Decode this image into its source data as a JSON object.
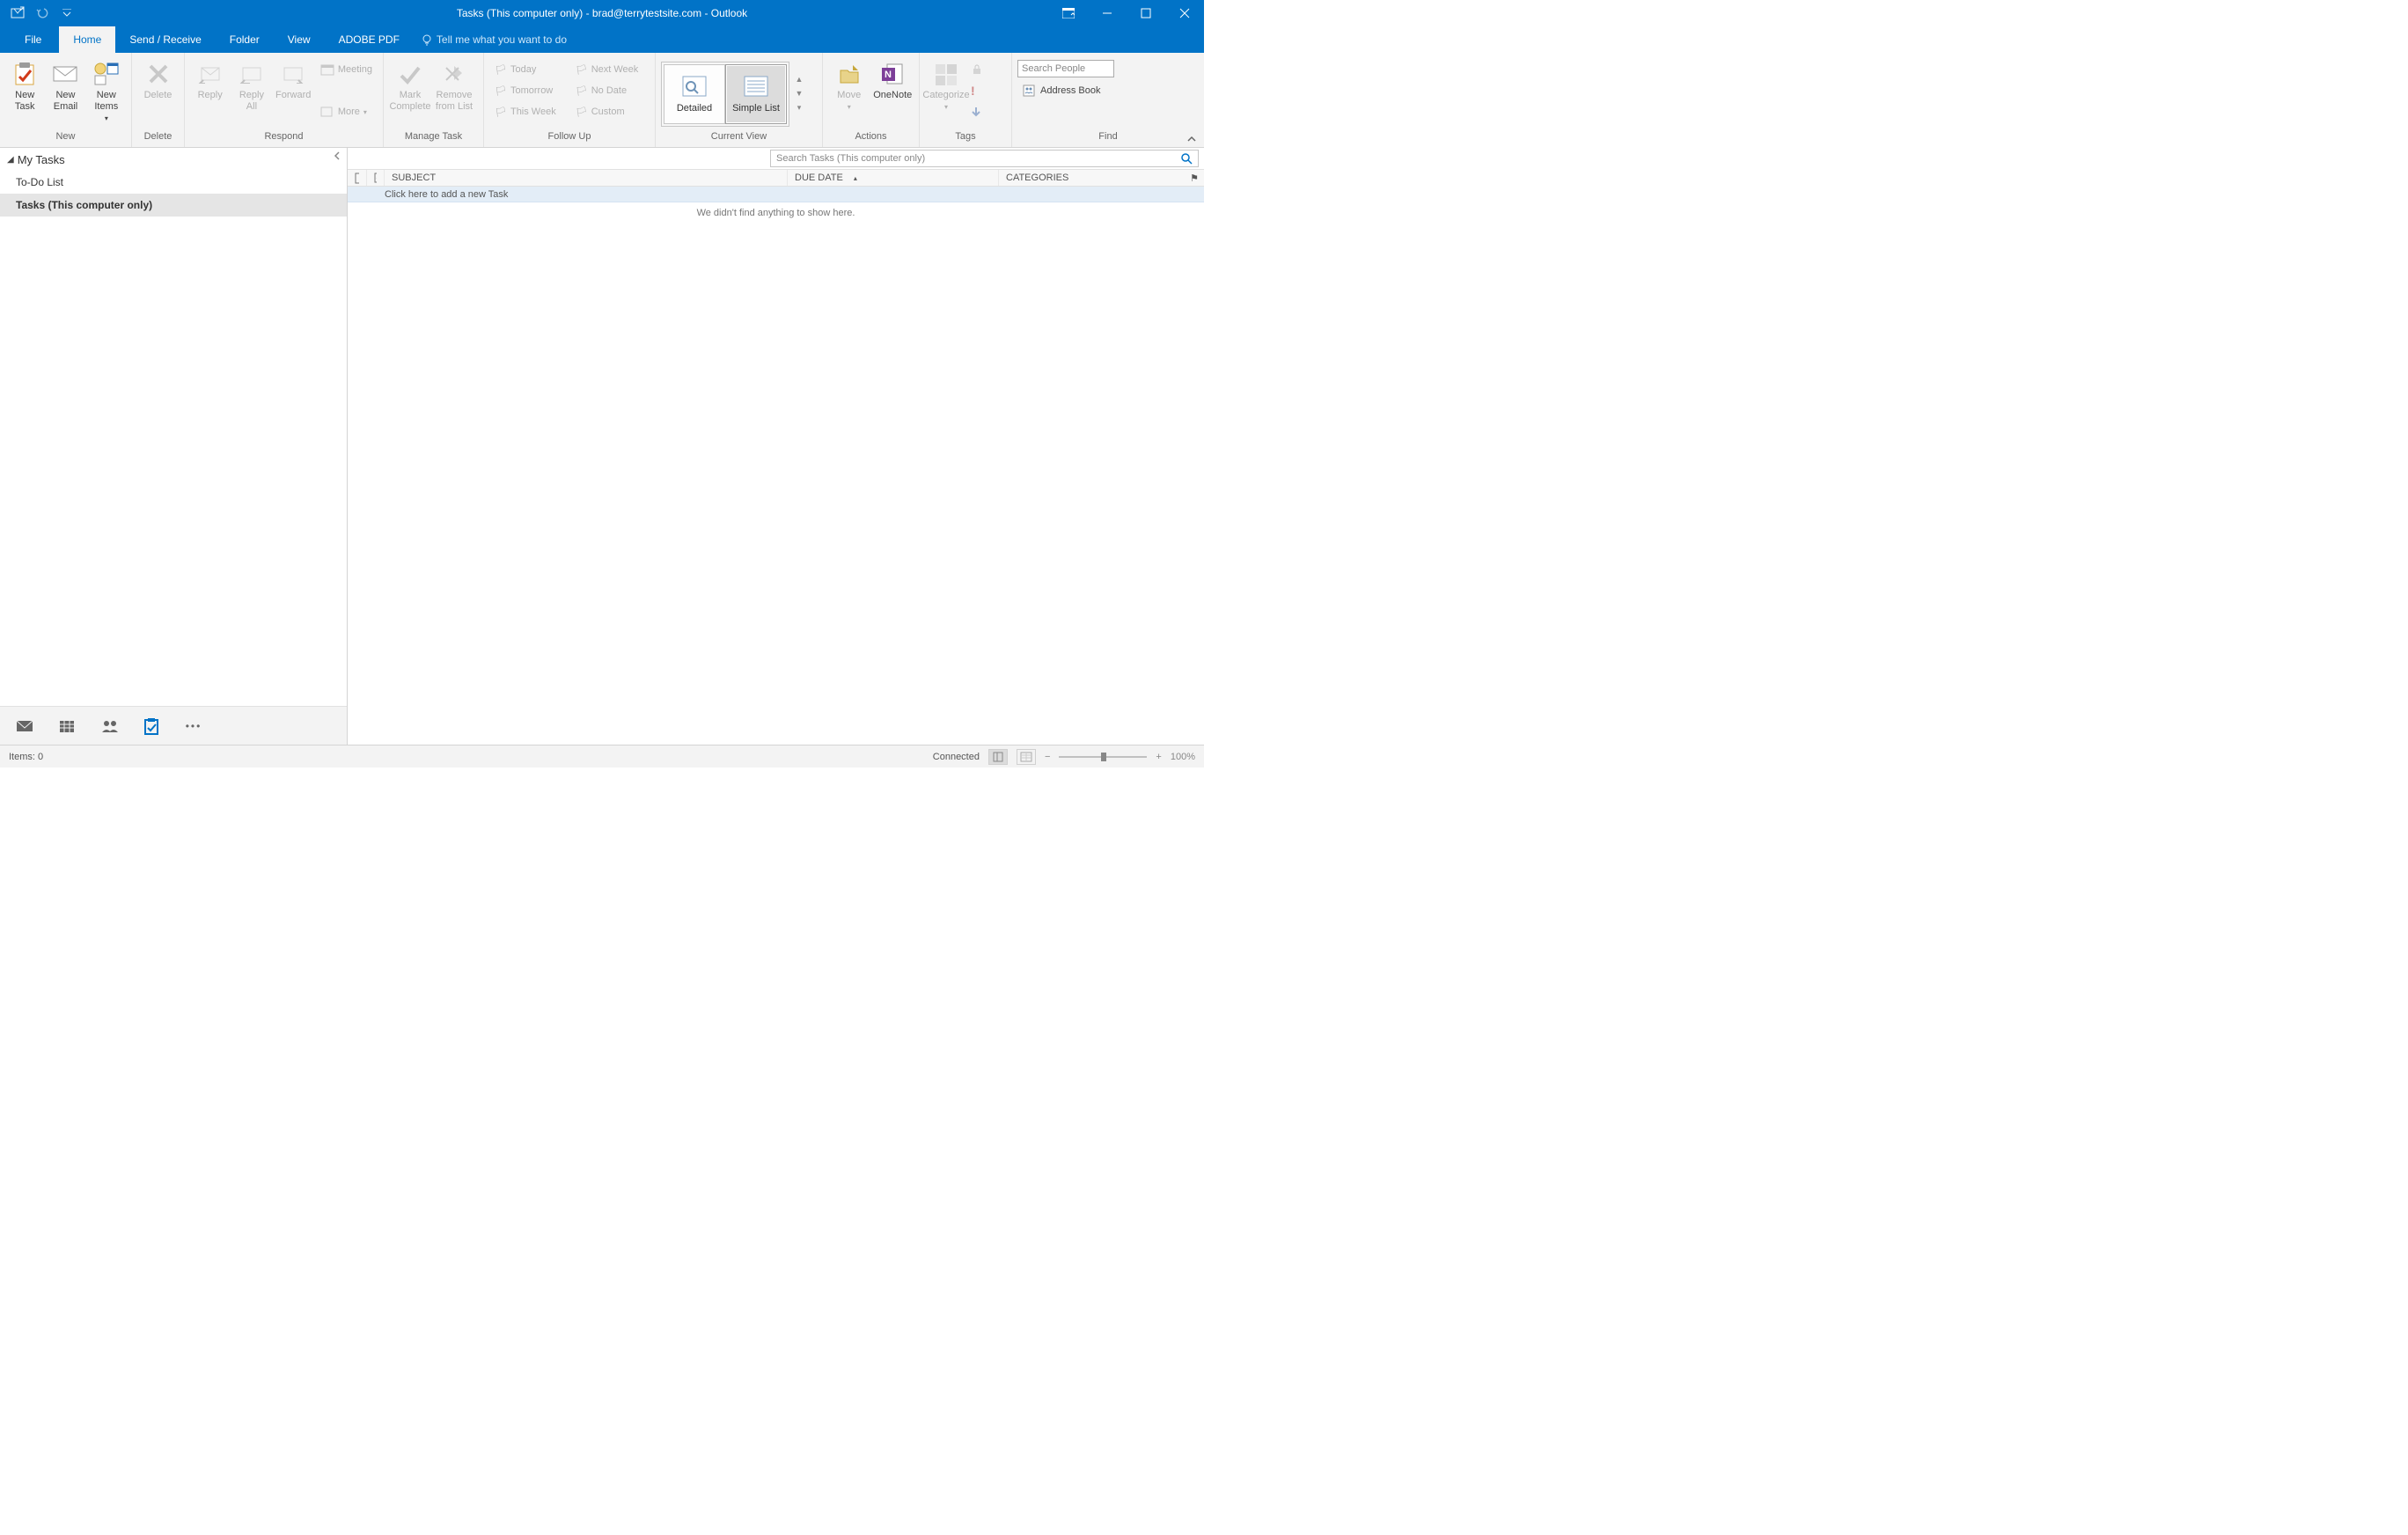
{
  "title": "Tasks (This computer only) - brad@terrytestsite.com  -  Outlook",
  "tabs": {
    "file": "File",
    "home": "Home",
    "sendrecv": "Send / Receive",
    "folder": "Folder",
    "view": "View",
    "adobe": "ADOBE PDF"
  },
  "tellme": "Tell me what you want to do",
  "ribbon": {
    "groups": {
      "new": "New",
      "delete": "Delete",
      "respond": "Respond",
      "manage": "Manage Task",
      "follow": "Follow Up",
      "view": "Current View",
      "actions": "Actions",
      "tags": "Tags",
      "find": "Find"
    },
    "new_task": "New\nTask",
    "new_email": "New\nEmail",
    "new_items": "New\nItems",
    "delete": "Delete",
    "reply": "Reply",
    "reply_all": "Reply\nAll",
    "forward": "Forward",
    "meeting": "Meeting",
    "more": "More",
    "mark_complete": "Mark\nComplete",
    "remove_list": "Remove\nfrom List",
    "today": "Today",
    "tomorrow": "Tomorrow",
    "this_week": "This Week",
    "next_week": "Next Week",
    "no_date": "No Date",
    "custom": "Custom",
    "detailed": "Detailed",
    "simple_list": "Simple List",
    "move": "Move",
    "onenote": "OneNote",
    "categorize": "Categorize",
    "search_people": "Search People",
    "address_book": "Address Book"
  },
  "nav": {
    "heading": "My Tasks",
    "todo": "To-Do List",
    "tasks": "Tasks (This computer only)"
  },
  "content": {
    "search_placeholder": "Search Tasks (This computer only)",
    "columns": {
      "subject": "SUBJECT",
      "due": "DUE DATE",
      "categories": "CATEGORIES"
    },
    "new_task_hint": "Click here to add a new Task",
    "empty": "We didn't find anything to show here."
  },
  "status": {
    "items": "Items: 0",
    "connected": "Connected",
    "zoom": "100%"
  }
}
